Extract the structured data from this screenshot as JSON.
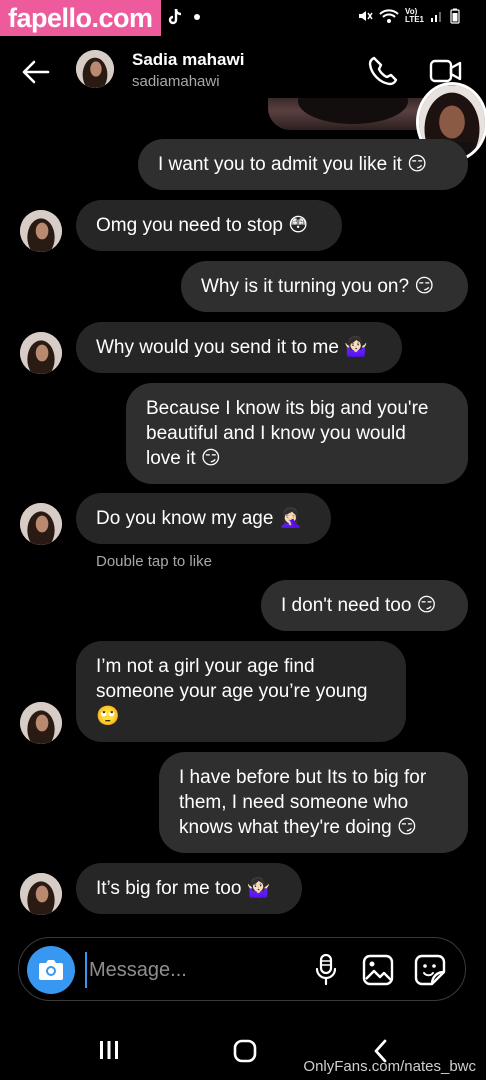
{
  "watermark_top": "fapello.com",
  "watermark_bottom": "OnlyFans.com/nates_bwc",
  "status_bar": {
    "left_icons": [
      "tiktok-icon",
      "dot-icon"
    ],
    "network_label": "Vo)\nLTE1",
    "right_icons": [
      "mute-icon",
      "wifi-icon",
      "signal-icon",
      "battery-icon"
    ]
  },
  "header": {
    "name": "Sadia mahawi",
    "username": "sadiamahawi"
  },
  "messages": [
    {
      "side": "sent",
      "text": "I want you to admit you like it 😏"
    },
    {
      "side": "received",
      "text": "Omg you need to stop 😳"
    },
    {
      "side": "sent",
      "text": "Why is it turning you on? 😏"
    },
    {
      "side": "received",
      "text": "Why would you send it to me 🤷🏻‍♀️"
    },
    {
      "side": "sent",
      "text": "Because I know its big and you're\nbeautiful and I know you would\nlove it 😏"
    },
    {
      "side": "received",
      "text": "Do you know my age 🤦🏻‍♀️"
    },
    {
      "side": "sent",
      "text": "I don't need too 😏"
    },
    {
      "side": "received",
      "text": "I’m not a girl your age find\nsomeone your age you’re young\n🙄"
    },
    {
      "side": "sent",
      "text": "I have before but Its to big for\nthem, I need someone who\nknows what they're doing 😏"
    },
    {
      "side": "received",
      "text": "It’s big for me too 🤷🏻‍♀️"
    }
  ],
  "hint": "Double tap to like",
  "composer": {
    "placeholder": "Message...",
    "icons": [
      "camera-icon",
      "microphone-icon",
      "gallery-icon",
      "sticker-icon"
    ]
  },
  "navbar": {
    "icons": [
      "recent-apps-icon",
      "home-icon",
      "back-icon"
    ]
  },
  "colors": {
    "background": "#000000",
    "bubble": "#262626",
    "accent": "#3897f0",
    "watermark": "#ee5b9c"
  }
}
